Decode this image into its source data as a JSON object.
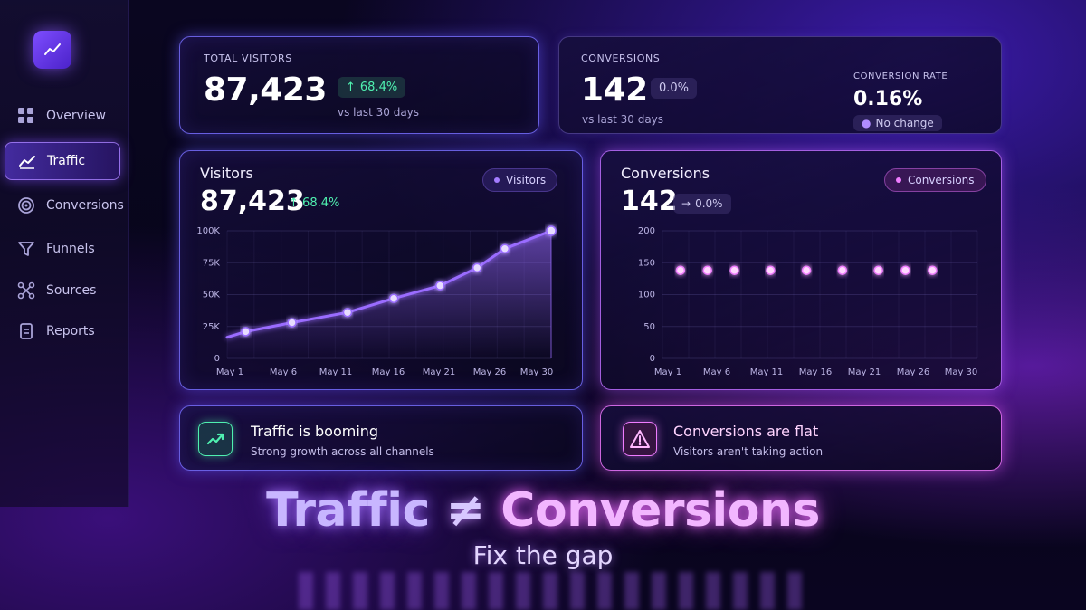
{
  "sidebar": {
    "logo_icon": "trend-line-icon",
    "items": [
      {
        "label": "Overview",
        "icon": "grid-icon",
        "active": false
      },
      {
        "label": "Traffic",
        "icon": "trend-line-icon",
        "active": true
      },
      {
        "label": "Conversions",
        "icon": "target-icon",
        "active": false
      },
      {
        "label": "Funnels",
        "icon": "funnel-icon",
        "active": false
      },
      {
        "label": "Sources",
        "icon": "nodes-icon",
        "active": false
      },
      {
        "label": "Reports",
        "icon": "document-icon",
        "active": false
      }
    ]
  },
  "kpis": {
    "visitors": {
      "label": "TOTAL VISITORS",
      "value": "87,423",
      "change": "68.4%",
      "period": "vs last 30 days"
    },
    "conversions": {
      "label": "CONVERSIONS",
      "value": "142",
      "change": "0.0%",
      "period": "vs last 30 days",
      "rate_label": "CONVERSION RATE",
      "rate_value": "0.16%",
      "rate_status": "No change"
    }
  },
  "visitors_chart": {
    "title": "Visitors",
    "value": "87,423",
    "change": "68.4%",
    "legend": "Visitors"
  },
  "conversions_chart": {
    "title": "Conversions",
    "value": "142",
    "change": "0.0%",
    "legend": "Conversions"
  },
  "chart_data": [
    {
      "type": "area",
      "title": "Visitors",
      "legend": [
        "Visitors"
      ],
      "x_ticks": [
        "May 1",
        "May 6",
        "May 11",
        "May 16",
        "May 21",
        "May 26",
        "May 30"
      ],
      "y_ticks": [
        "0",
        "25K",
        "50K",
        "75K",
        "100K"
      ],
      "ylim": [
        0,
        100000
      ],
      "xlim": [
        1,
        30
      ],
      "series": [
        {
          "name": "Visitors",
          "x": [
            1,
            3,
            8,
            14,
            19,
            24,
            28,
            31,
            36
          ],
          "y": [
            16500,
            21000,
            28000,
            36000,
            47000,
            57000,
            71000,
            86000,
            100000
          ]
        }
      ],
      "grid": true
    },
    {
      "type": "line",
      "title": "Conversions",
      "legend": [
        "Conversions"
      ],
      "x_ticks": [
        "May 1",
        "May 6",
        "May 11",
        "May 16",
        "May 21",
        "May 26",
        "May 30"
      ],
      "y_ticks": [
        "0",
        "50",
        "100",
        "150",
        "200"
      ],
      "ylim": [
        0,
        200
      ],
      "series": [
        {
          "name": "Conversions",
          "x": [
            1,
            3,
            6,
            9,
            13,
            17,
            21,
            25,
            28,
            31
          ],
          "y": [
            138,
            138,
            138,
            138,
            138,
            138,
            138,
            138,
            138,
            138
          ]
        }
      ],
      "grid": true
    }
  ],
  "insights": [
    {
      "title": "Traffic is booming",
      "subtitle": "Strong growth across all channels",
      "icon": "trend-up-icon"
    },
    {
      "title": "Conversions are flat",
      "subtitle": "Visitors aren't taking action",
      "icon": "warning-icon"
    }
  ],
  "headline": {
    "part1": "Traffic",
    "symbol": "≠",
    "part2": "Conversions",
    "subtitle": "Fix the gap"
  },
  "colors": {
    "accent": "#7d4dff",
    "growth": "#4ff0b0",
    "conversion": "#f07cff"
  }
}
